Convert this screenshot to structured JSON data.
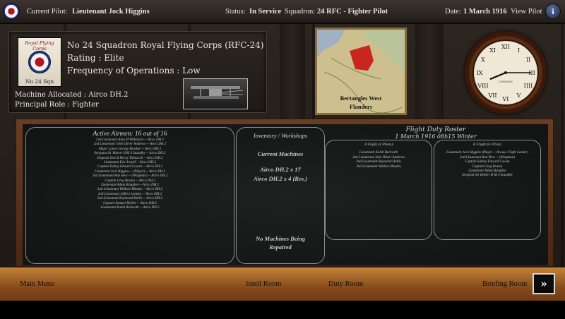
{
  "topbar": {
    "pilot_label": "Current Pilot:",
    "pilot_name": "Lieutenant Jock Higgins",
    "status_label": "Status:",
    "status_value": "In Service",
    "squadron_label": "Squadron:",
    "squadron_value": "24 RFC - Fighter Pilot",
    "date_label": "Date:",
    "date_value": "1 March 1916",
    "view_pilot": "View Pilot",
    "info_glyph": "i"
  },
  "squadron": {
    "badge_top": "Royal Flying Corps",
    "badge_bottom": "No 24 Sqn",
    "name": "No 24 Squadron Royal Flying Corps (RFC-24)",
    "rating": "Rating : Elite",
    "frequency": "Frequency of Operations : Low",
    "machine": "Machine Allocated : Airco DH.2",
    "role": "Principal Role : Fighter"
  },
  "map": {
    "line1": "Bertangles West",
    "line2": "Flanders"
  },
  "clock": {
    "numerals": [
      "XII",
      "I",
      "II",
      "III",
      "IIII",
      "V",
      "VI",
      "VII",
      "VIII",
      "IX",
      "X",
      "XI"
    ],
    "hour": 8,
    "minute": 15,
    "brand": "LONDON"
  },
  "board": {
    "airmen_title": "Active Airmen: 16 out of 16",
    "airmen": [
      "2nd Lieutenant Alan M Wilkinson -- Airco DH.2",
      "2nd Lieutenant John Oliver Andrews -- Airco DH.2",
      "Major Lanoe George Hawker -- Airco DH.2",
      "Sergeant Sir Robert H M S Saundby -- Airco DH.2",
      "Sergeant David Henry Tidmarsh -- Airco DH.2",
      "Lieutenant Eric Lenell -- Airco DH.2",
      "Captain Sidney Edward Cowan -- Airco DH.2",
      "Lieutenant Jock Higgins -- (Player) -- Airco DH.2",
      "2nd Lieutenant Ron Hew -- (Wingman) -- Airco DH.2",
      "Captain Greg Bruton -- Airco DH.2",
      "Lieutenant Adam Byngdon -- Airco DH.2",
      "2nd Lieutenant Wallace Rhodes -- Airco DH.2",
      "2nd Lieutenant Jeffrey London -- Airco DH.2",
      "2nd Lieutenant Raymond Hollis -- Airco DH.2",
      "Captain Samuel Moller -- Airco DH.2",
      "Lieutenant Kaleb Beckwith -- Airco DH.2"
    ],
    "inventory_title": "Inventory / Workshops",
    "current_machines_label": "Current Machines",
    "machines": [
      "Airco DH.2 x 17",
      "Airco DH.2 x 4 (Res.)"
    ],
    "no_machines": [
      "No Machines Being",
      "Repaired"
    ],
    "roster_title": "Flight Duty Roster",
    "roster_subtitle": "1 March 1916 08h15 Winter",
    "flight_a_title": "A Flight  (4 Pilots)",
    "flight_a": [
      "Lieutenant Kaleb Beckwith",
      "2nd Lieutenant John Oliver Andrews",
      "2nd Lieutenant Raymond Hollis",
      "2nd Lieutenant Wallace Rhodes"
    ],
    "flight_b_title": "B Flight  (6 Pilots)",
    "flight_b": [
      "Lieutenant Jock Higgins (Player -- Always Flight Leader)",
      "2nd Lieutenant Ron Hew -- (Wingman)",
      "Captain Sidney Edward Cowan",
      "Captain Greg Bruton",
      "Lieutenant Adam Byngdon",
      "Sergeant Sir Robert H M S Saundby"
    ]
  },
  "nav": {
    "main_menu": "Main Menu",
    "intell_room": "Intell Room",
    "duty_room": "Duty Room",
    "briefing_room": "Briefing Room",
    "next_glyph": "»"
  }
}
